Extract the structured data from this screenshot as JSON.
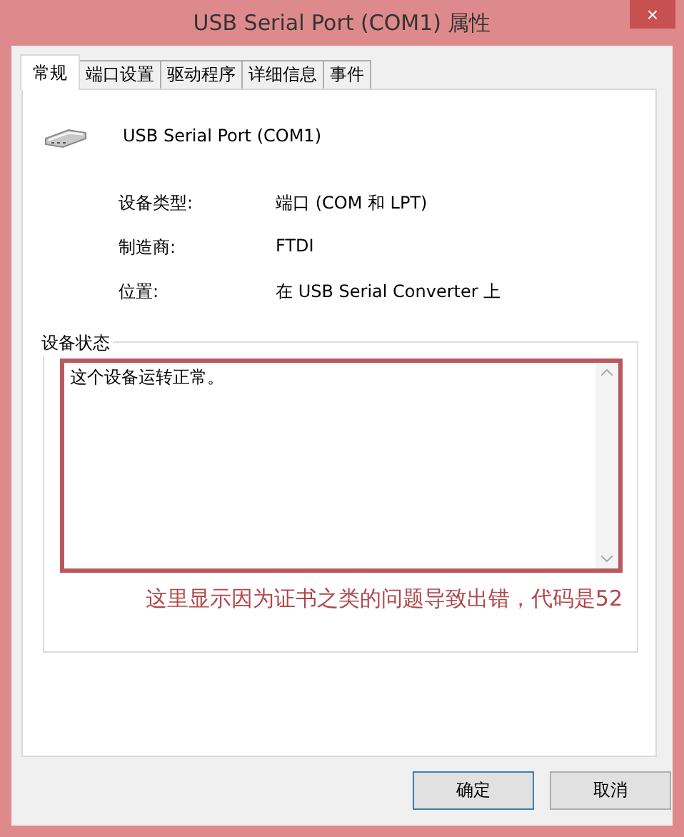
{
  "window": {
    "title": "USB Serial Port (COM1) 属性",
    "close": "×"
  },
  "tabs": [
    {
      "label": "常规",
      "selected": true
    },
    {
      "label": "端口设置",
      "selected": false
    },
    {
      "label": "驱动程序",
      "selected": false
    },
    {
      "label": "详细信息",
      "selected": false
    },
    {
      "label": "事件",
      "selected": false
    }
  ],
  "device": {
    "name": "USB Serial Port (COM1)"
  },
  "properties": [
    {
      "label": "设备类型:",
      "value": "端口 (COM 和 LPT)"
    },
    {
      "label": "制造商:",
      "value": "FTDI"
    },
    {
      "label": "位置:",
      "value": "在 USB Serial Converter 上"
    }
  ],
  "device_status": {
    "title": "设备状态",
    "text": "这个设备运转正常。"
  },
  "annotation": "这里显示因为证书之类的问题导致出错，代码是52",
  "buttons": [
    {
      "label": "确定",
      "default": true
    },
    {
      "label": "取消",
      "default": false
    }
  ]
}
